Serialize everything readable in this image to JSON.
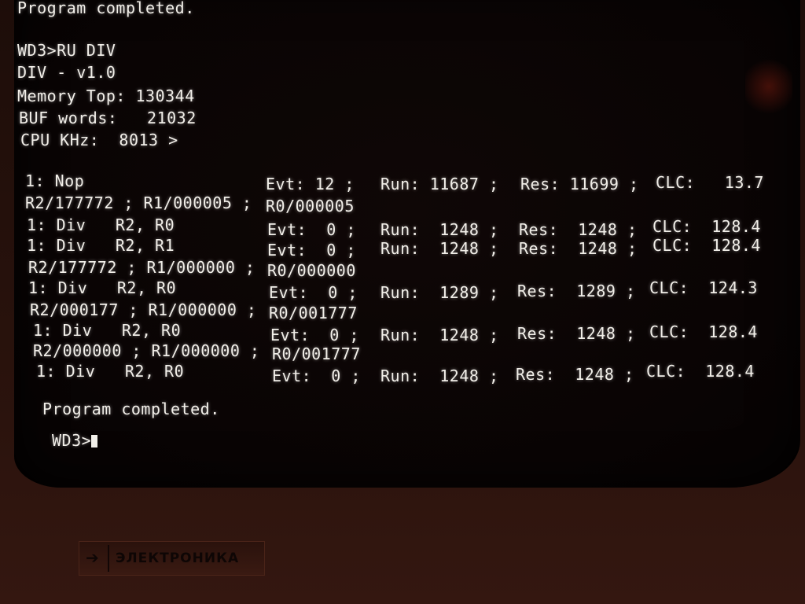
{
  "screen": {
    "lines": [
      "Program completed.",
      "WD3>RU DIV",
      "DIV - v1.0",
      "Memory Top: 130344",
      "BUF words:   21032",
      "CPU KHz:  8013 >"
    ],
    "results": [
      {
        "left": "1: Nop",
        "mid": "Evt: 12 ;",
        "run": "Run: 11687 ;",
        "res": "Res: 11699 ;",
        "clc": "CLC:   13.7"
      },
      {
        "left": "R2/177772 ; R1/000005 ;",
        "mid": "R0/000005"
      },
      {
        "left": "1: Div   R2, R0",
        "mid": "Evt:  0 ;",
        "run": "Run:  1248 ;",
        "res": "Res:  1248 ;",
        "clc": "CLC:  128.4"
      },
      {
        "left": "1: Div   R2, R1",
        "mid": "Evt:  0 ;",
        "run": "Run:  1248 ;",
        "res": "Res:  1248 ;",
        "clc": "CLC:  128.4"
      },
      {
        "left": "R2/177772 ; R1/000000 ;",
        "mid": "R0/000000"
      },
      {
        "left": "1: Div   R2, R0",
        "mid": "Evt:  0 ;",
        "run": "Run:  1289 ;",
        "res": "Res:  1289 ;",
        "clc": "CLC:  124.3"
      },
      {
        "left": "R2/000177 ; R1/000000 ;",
        "mid": "R0/001777"
      },
      {
        "left": "1: Div   R2, R0",
        "mid": "Evt:  0 ;",
        "run": "Run:  1248 ;",
        "res": "Res:  1248 ;",
        "clc": "CLC:  128.4"
      },
      {
        "left": "R2/000000 ; R1/000000 ;",
        "mid": "R0/001777"
      },
      {
        "left": "1: Div   R2, R0",
        "mid": "Evt:  0 ;",
        "run": "Run:  1248 ;",
        "res": "Res:  1248 ;",
        "clc": "CLC:  128.4"
      }
    ],
    "completed": "Program completed.",
    "prompt": "WD3>"
  },
  "badge": {
    "brand": "ЭЛЕКТРОНИКА"
  },
  "colors": {
    "phosphor": "#f2efe9",
    "screen_bg": "#090404",
    "bezel": "#2b130d"
  }
}
